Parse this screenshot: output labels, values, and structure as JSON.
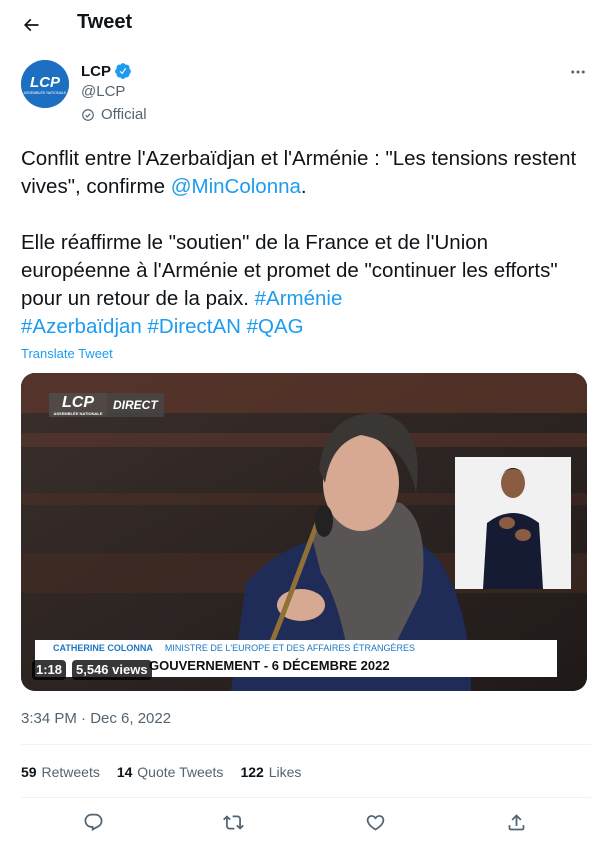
{
  "header": {
    "title": "Tweet",
    "back_icon": "arrow-left-icon"
  },
  "author": {
    "name": "LCP",
    "handle": "@LCP",
    "label": "Official",
    "avatar_text": "LCP",
    "avatar_subtext": "ASSEMBLÉE NATIONALE",
    "verified": true
  },
  "tweet": {
    "line1_pre": "Conflit entre l'Azerbaïdjan et l'Arménie : \"Les tensions restent vives\", confirme ",
    "mention": "@MinColonna",
    "line1_post": ".",
    "para2": "Elle réaffirme le \"soutien\" de la France et de l'Union européenne à l'Arménie et promet de \"continuer les efforts\" pour un retour de la paix. ",
    "hashtags": [
      "#Arménie",
      "#Azerbaïdjan",
      "#DirectAN",
      "#QAG"
    ],
    "translate_label": "Translate Tweet"
  },
  "media": {
    "logo": "LCP",
    "logo_subtext": "ASSEMBLÉE NATIONALE",
    "live_label": "DIRECT",
    "caption_name": "CATHERINE COLONNA",
    "caption_role": "MINISTRE DE L'EUROPE ET DES AFFAIRES ÉTRANGÈRES",
    "caption_bottom": "GOUVERNEMENT - 6 DÉCEMBRE 2022",
    "duration": "1:18",
    "views": "5,546 views"
  },
  "meta": {
    "timestamp": "3:34 PM · Dec 6, 2022"
  },
  "stats": [
    {
      "count": "59",
      "label": "Retweets"
    },
    {
      "count": "14",
      "label": "Quote Tweets"
    },
    {
      "count": "122",
      "label": "Likes"
    }
  ],
  "actions": [
    {
      "name": "reply",
      "icon": "reply-icon"
    },
    {
      "name": "retweet",
      "icon": "retweet-icon"
    },
    {
      "name": "like",
      "icon": "heart-icon"
    },
    {
      "name": "share",
      "icon": "share-icon"
    }
  ],
  "colors": {
    "link": "#1d9bf0",
    "text": "#0f1419",
    "secondary": "#536471",
    "verified": "#1d9bf0",
    "avatar_bg": "#1d6fc2"
  }
}
